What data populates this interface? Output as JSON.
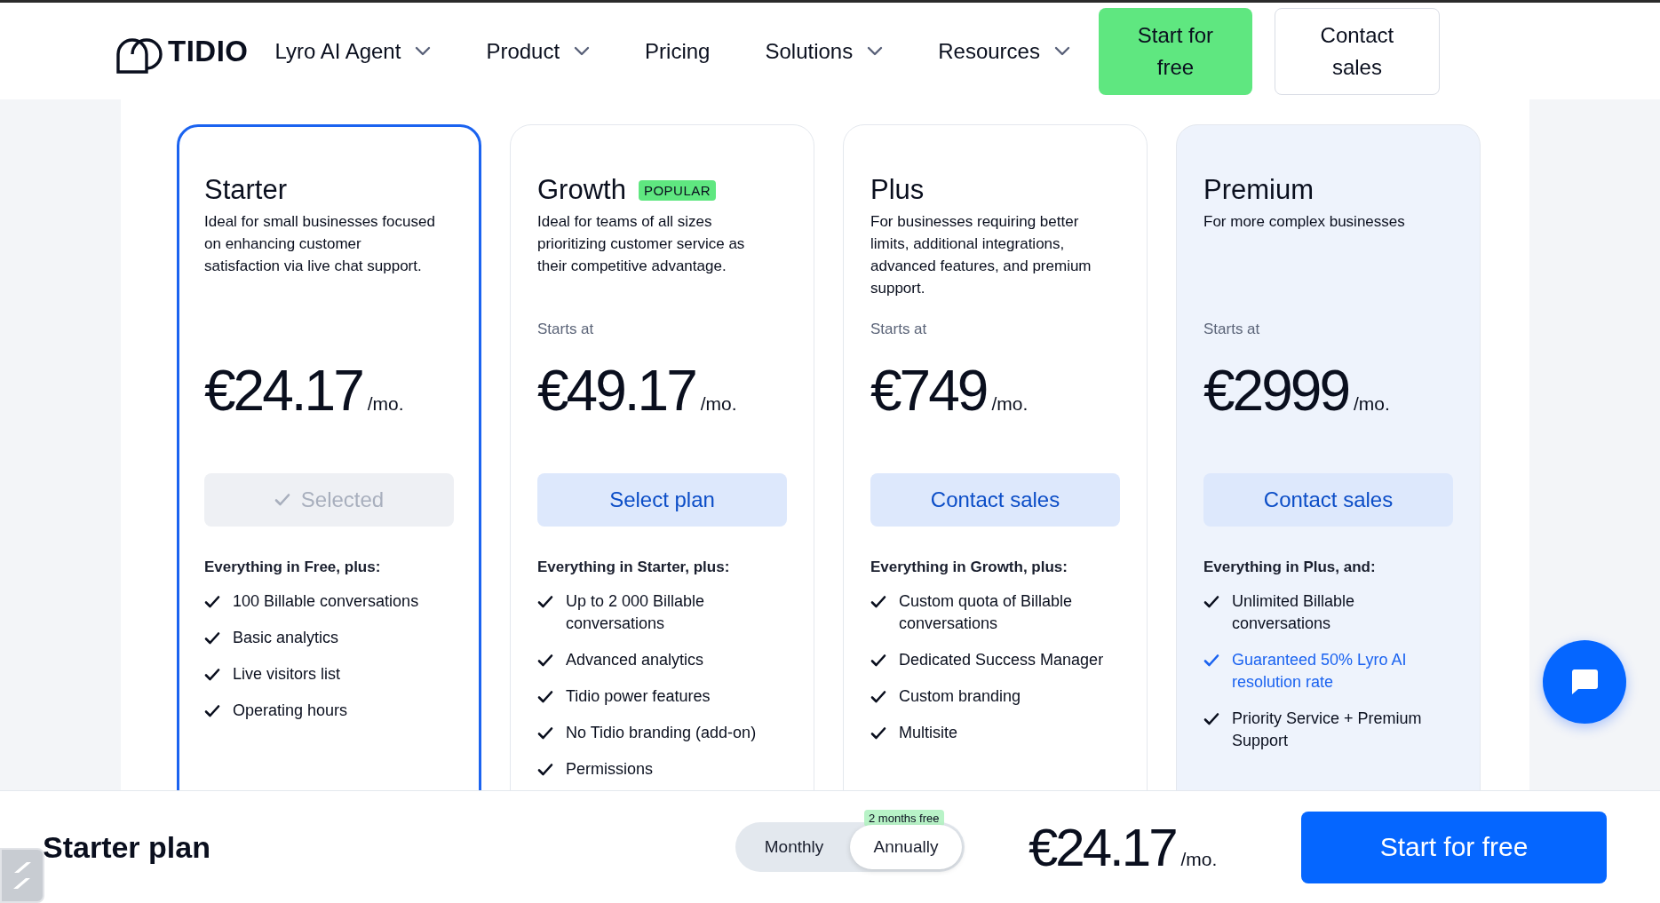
{
  "nav": {
    "logo": "TIDIO",
    "items": [
      {
        "label": "Lyro AI Agent",
        "dropdown": true
      },
      {
        "label": "Product",
        "dropdown": true
      },
      {
        "label": "Pricing",
        "dropdown": false
      },
      {
        "label": "Solutions",
        "dropdown": true
      },
      {
        "label": "Resources",
        "dropdown": true
      }
    ],
    "buttons": [
      {
        "label": "Start for free",
        "kind": "primary"
      },
      {
        "label": "Contact sales",
        "kind": "outline"
      }
    ]
  },
  "plans": [
    {
      "name": "Starter",
      "description": "Ideal for small businesses focused on enhancing customer satisfaction via live chat support.",
      "price": "€24.17",
      "period": "/mo.",
      "selected": true,
      "tinted": false,
      "button": "Selected",
      "features_heading": "Everything in Free, plus:",
      "features": [
        {
          "text": "100 Billable conversations",
          "highlight": false
        },
        {
          "text": "Basic analytics",
          "highlight": false
        },
        {
          "text": "Live visitors list",
          "highlight": false
        },
        {
          "text": "Operating hours",
          "highlight": false
        }
      ]
    },
    {
      "name": "Growth",
      "badge": "POPULAR",
      "description": "Ideal for teams of all sizes prioritizing customer service as their competitive advantage.",
      "starts_at": "Starts at",
      "price": "€49.17",
      "period": "/mo.",
      "selected": false,
      "tinted": false,
      "button": "Select plan",
      "features_heading": "Everything in Starter, plus:",
      "features": [
        {
          "text": "Up to 2 000 Billable conversations",
          "highlight": false
        },
        {
          "text": "Advanced analytics",
          "highlight": false
        },
        {
          "text": "Tidio power features",
          "highlight": false
        },
        {
          "text": "No Tidio branding (add-on)",
          "highlight": false
        },
        {
          "text": "Permissions",
          "highlight": false
        }
      ]
    },
    {
      "name": "Plus",
      "description": "For businesses requiring better limits, additional integrations, advanced features, and premium support.",
      "starts_at": "Starts at",
      "price": "€749",
      "period": "/mo.",
      "selected": false,
      "tinted": false,
      "button": "Contact sales",
      "features_heading": "Everything in Growth, plus:",
      "features": [
        {
          "text": "Custom quota of Billable conversations",
          "highlight": false
        },
        {
          "text": "Dedicated Success Manager",
          "highlight": false
        },
        {
          "text": "Custom branding",
          "highlight": false
        },
        {
          "text": "Multisite",
          "highlight": false
        }
      ]
    },
    {
      "name": "Premium",
      "description": "For more complex businesses",
      "starts_at": "Starts at",
      "price": "€2999",
      "period": "/mo.",
      "selected": false,
      "tinted": true,
      "button": "Contact sales",
      "features_heading": "Everything in Plus, and:",
      "features": [
        {
          "text": "Unlimited Billable conversations",
          "highlight": false
        },
        {
          "text": "Guaranteed 50% Lyro AI resolution rate",
          "highlight": true
        },
        {
          "text": "Priority Service + Premium Support",
          "highlight": false
        }
      ]
    }
  ],
  "footer": {
    "plan": "Starter plan",
    "billing": [
      {
        "label": "Monthly",
        "selected": false
      },
      {
        "label": "Annually",
        "selected": true,
        "badge": "2 months free"
      }
    ],
    "price": "€24.17",
    "period": "/mo.",
    "button": "Start for free"
  }
}
